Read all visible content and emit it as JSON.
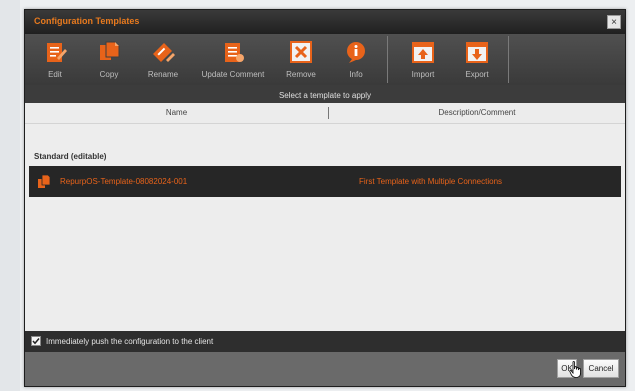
{
  "dialog": {
    "title": "Configuration Templates",
    "close_glyph": "×"
  },
  "toolbar": {
    "buttons": [
      {
        "label": "Edit",
        "icon": "edit-icon"
      },
      {
        "label": "Copy",
        "icon": "copy-icon"
      },
      {
        "label": "Rename",
        "icon": "rename-icon"
      },
      {
        "label": "Update Comment",
        "icon": "update-comment-icon"
      },
      {
        "label": "Remove",
        "icon": "remove-icon"
      },
      {
        "label": "Info",
        "icon": "info-icon"
      },
      {
        "label": "Import",
        "icon": "import-icon"
      },
      {
        "label": "Export",
        "icon": "export-icon"
      }
    ]
  },
  "apply_bar": {
    "text": "Select a template to apply"
  },
  "columns": {
    "name": "Name",
    "description": "Description/Comment"
  },
  "list": {
    "section_title": "Standard (editable)",
    "rows": [
      {
        "name": "RepurpOS-Template-08082024-001",
        "description": "First Template with Multiple Connections"
      }
    ]
  },
  "options": {
    "push_label": "Immediately push the configuration to the client",
    "push_checked": true
  },
  "footer": {
    "ok_label": "OK",
    "cancel_label": "Cancel"
  },
  "colors": {
    "accent": "#e8631a",
    "title_accent": "#e87a1e",
    "toolbar_bg": "#444444",
    "row_selected_bg": "#262626"
  }
}
